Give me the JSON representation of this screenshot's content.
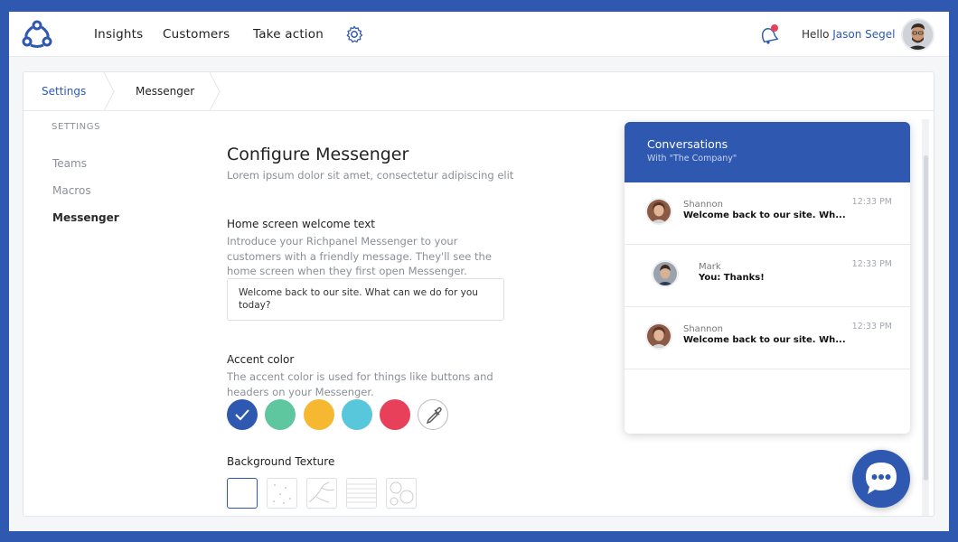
{
  "nav": {
    "items": [
      "Insights",
      "Customers",
      "Take action"
    ],
    "greeting": "Hello",
    "user_name": "Jason Segel",
    "notification_dot_color": "#e8405b"
  },
  "breadcrumb": {
    "items": [
      "Settings",
      "Messenger"
    ]
  },
  "sidebar": {
    "heading": "SETTINGS",
    "items": [
      {
        "label": "Teams",
        "active": false
      },
      {
        "label": "Macros",
        "active": false
      },
      {
        "label": "Messenger",
        "active": true
      }
    ]
  },
  "main": {
    "title": "Configure Messenger",
    "subtitle": "Lorem ipsum dolor sit amet, consectetur adipiscing elit",
    "welcome": {
      "title": "Home screen welcome text",
      "desc": "Introduce your Richpanel Messenger to your customers with a friendly message. They'll see the home screen when they first open Messenger.",
      "value": "Welcome back to our site. What can we do for you today?"
    },
    "accent": {
      "title": "Accent color",
      "desc": "The accent color is used for things like buttons and headers on your Messenger.",
      "colors": [
        "#2f58b0",
        "#5ec7a0",
        "#f6b731",
        "#59c7db",
        "#e8405b"
      ],
      "selected": "#2f58b0"
    },
    "texture": {
      "title": "Background Texture",
      "options": [
        "plain",
        "dots",
        "branches",
        "lines",
        "circles"
      ],
      "selected": "plain"
    }
  },
  "preview": {
    "title": "Conversations",
    "subtitle": "With \"The Company\"",
    "conversations": [
      {
        "name": "Shannon",
        "message": "Welcome back to our site. Wh...",
        "time": "12:33 PM"
      },
      {
        "name": "Mark",
        "message": "You: Thanks!",
        "time": "12:33 PM"
      },
      {
        "name": "Shannon",
        "message": "Welcome back to our site. Wh...",
        "time": "12:33 PM"
      }
    ]
  },
  "colors": {
    "brand": "#2f58b0",
    "muted_text": "#8a8f98"
  }
}
